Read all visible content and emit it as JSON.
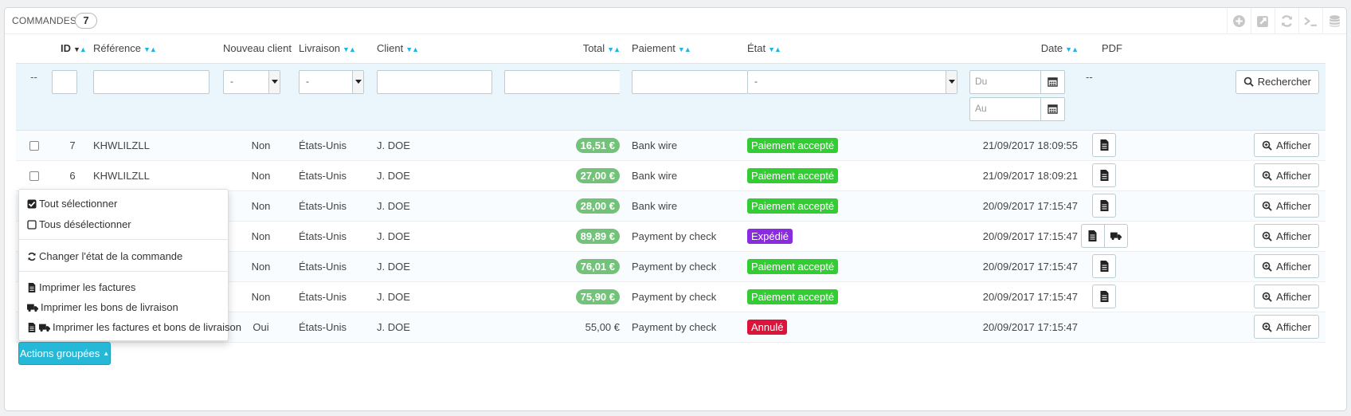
{
  "panel": {
    "title": "Commandes",
    "count": "7"
  },
  "toolbar": [
    "add-icon",
    "export-icon",
    "refresh-icon",
    "sql-icon",
    "database-icon"
  ],
  "columns": {
    "id": "ID",
    "reference": "Référence",
    "new_client": "Nouveau client",
    "delivery": "Livraison",
    "client": "Client",
    "total": "Total",
    "payment": "Paiement",
    "state": "État",
    "date": "Date",
    "pdf": "PDF"
  },
  "filters": {
    "dashes": "--",
    "new_client_select": "-",
    "delivery_select": "-",
    "state_select": "-",
    "date_from_placeholder": "Du",
    "date_to_placeholder": "Au",
    "pdf_dashes": "--",
    "search_label": "Rechercher"
  },
  "rows": [
    {
      "id": "7",
      "reference": "KHWLILZLL",
      "new_client": "Non",
      "delivery": "États-Unis",
      "client": "J. DOE",
      "total": "16,51 €",
      "total_badge": true,
      "payment": "Bank wire",
      "state": "Paiement accepté",
      "state_color": "#32cd32",
      "date": "21/09/2017 18:09:55",
      "pdf": "invoice",
      "view": "Afficher"
    },
    {
      "id": "6",
      "reference": "KHWLILZLL",
      "new_client": "Non",
      "delivery": "États-Unis",
      "client": "J. DOE",
      "total": "27,00 €",
      "total_badge": true,
      "payment": "Bank wire",
      "state": "Paiement accepté",
      "state_color": "#32cd32",
      "date": "21/09/2017 18:09:21",
      "pdf": "invoice",
      "view": "Afficher"
    },
    {
      "id": "",
      "reference": "",
      "new_client": "Non",
      "delivery": "États-Unis",
      "client": "J. DOE",
      "total": "28,00 €",
      "total_badge": true,
      "payment": "Bank wire",
      "state": "Paiement accepté",
      "state_color": "#32cd32",
      "date": "20/09/2017 17:15:47",
      "pdf": "invoice",
      "view": "Afficher"
    },
    {
      "id": "",
      "reference": "",
      "new_client": "Non",
      "delivery": "États-Unis",
      "client": "J. DOE",
      "total": "89,89 €",
      "total_badge": true,
      "payment": "Payment by check",
      "state": "Expédié",
      "state_color": "#8a2be2",
      "date": "20/09/2017 17:15:47",
      "pdf": "invoice-delivery",
      "view": "Afficher"
    },
    {
      "id": "",
      "reference": "",
      "new_client": "Non",
      "delivery": "États-Unis",
      "client": "J. DOE",
      "total": "76,01 €",
      "total_badge": true,
      "payment": "Payment by check",
      "state": "Paiement accepté",
      "state_color": "#32cd32",
      "date": "20/09/2017 17:15:47",
      "pdf": "invoice",
      "view": "Afficher"
    },
    {
      "id": "",
      "reference": "",
      "new_client": "Non",
      "delivery": "États-Unis",
      "client": "J. DOE",
      "total": "75,90 €",
      "total_badge": true,
      "payment": "Payment by check",
      "state": "Paiement accepté",
      "state_color": "#32cd32",
      "date": "20/09/2017 17:15:47",
      "pdf": "invoice",
      "view": "Afficher"
    },
    {
      "id": "",
      "reference": "",
      "new_client": "Oui",
      "delivery": "États-Unis",
      "client": "J. DOE",
      "total": "55,00 €",
      "total_badge": false,
      "payment": "Payment by check",
      "state": "Annulé",
      "state_color": "#dc143c",
      "date": "20/09/2017 17:15:47",
      "pdf": "none",
      "view": "Afficher"
    }
  ],
  "bulk_menu": {
    "select_all": "Tout sélectionner",
    "unselect_all": "Tous désélectionner",
    "change_state": "Changer l'état de la commande",
    "print_invoices": "Imprimer les factures",
    "print_delivery": "Imprimer les bons de livraison",
    "print_both": "Imprimer les factures et bons de livraison"
  },
  "bulk_button": "Actions groupées"
}
